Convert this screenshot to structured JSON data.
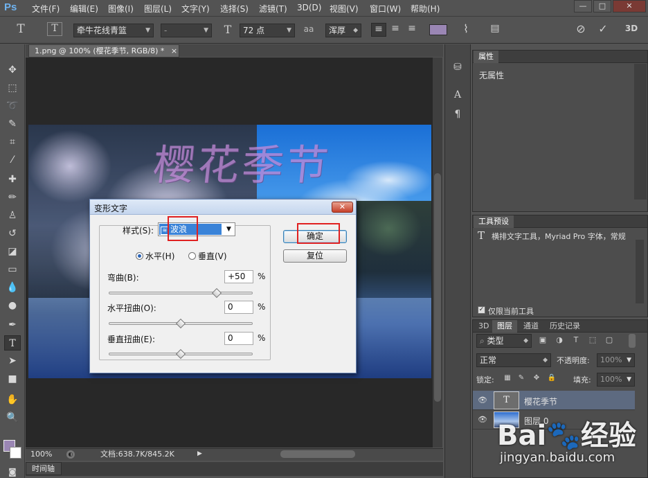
{
  "app": {
    "logo": "Ps"
  },
  "menu": [
    "文件(F)",
    "编辑(E)",
    "图像(I)",
    "图层(L)",
    "文字(Y)",
    "选择(S)",
    "滤镜(T)",
    "3D(D)",
    "视图(V)",
    "窗口(W)",
    "帮助(H)"
  ],
  "window_controls": {
    "minimize": "—",
    "restore": "□",
    "close": "✕"
  },
  "options": {
    "font_family": "牵牛花线青篮",
    "font_style": "-",
    "font_size": "72 点",
    "antialias_glyph": "aa",
    "antialias": "浑厚",
    "threed": "3D"
  },
  "document": {
    "tab_title": "1.png @ 100% (樱花季节, RGB/8) *",
    "tab_close": "×",
    "art_text": "樱花季节"
  },
  "status": {
    "zoom": "100%",
    "doc_size": "文档:638.7K/845.2K",
    "timeline_tab": "时间轴"
  },
  "properties_panel": {
    "tab": "属性",
    "empty_text": "无属性"
  },
  "tool_presets_panel": {
    "tab": "工具预设",
    "item_icon": "T",
    "item": "横排文字工具，Myriad Pro 字体，常规",
    "current_only": "仅限当前工具"
  },
  "layers_panel": {
    "tabs": [
      "3D",
      "图层",
      "通道",
      "历史记录"
    ],
    "filter": "类型",
    "blend_mode": "正常",
    "opacity_label": "不透明度:",
    "opacity_value": "100%",
    "lock_label": "锁定:",
    "fill_label": "填充:",
    "fill_value": "100%",
    "layers": [
      {
        "name": "樱花季节",
        "thumb": "T"
      },
      {
        "name": "图层 0"
      }
    ]
  },
  "warp_dialog": {
    "title": "变形文字",
    "close": "✕",
    "style_label": "样式(S):",
    "style_value": "波浪",
    "horizontal": "水平(H)",
    "vertical": "垂直(V)",
    "bend_label": "弯曲(B):",
    "bend_value": "+50",
    "hdistort_label": "水平扭曲(O):",
    "hdistort_value": "0",
    "vdistort_label": "垂直扭曲(E):",
    "vdistort_value": "0",
    "percent": "%",
    "ok": "确定",
    "reset": "复位",
    "bend_percent": 50,
    "hdistort_percent": 0,
    "vdistort_percent": 0
  },
  "watermark": {
    "logo": "Bai🐾经验",
    "url": "jingyan.baidu.com"
  }
}
